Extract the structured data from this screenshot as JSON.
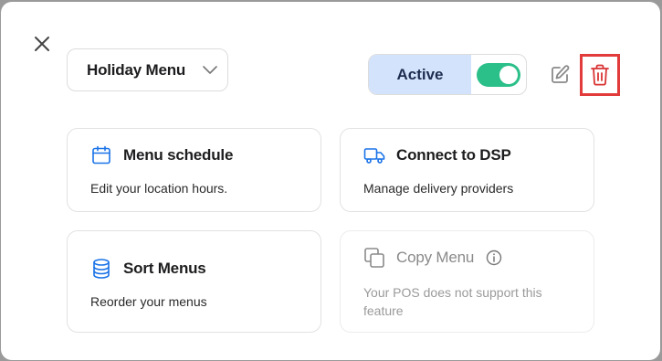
{
  "menu_selector": {
    "value": "Holiday Menu"
  },
  "status": {
    "label": "Active",
    "toggle_on": true
  },
  "colors": {
    "accent": "#1a73e8",
    "active_bg": "#d3e3fc",
    "toggle": "#2bbf8a",
    "delete": "#e23b3b"
  },
  "cards": [
    {
      "title": "Menu schedule",
      "description": "Edit your location hours.",
      "icon": "calendar-icon",
      "enabled": true
    },
    {
      "title": "Connect to DSP",
      "description": "Manage delivery providers",
      "icon": "truck-icon",
      "enabled": true
    },
    {
      "title": "Sort Menus",
      "description": "Reorder your menus",
      "icon": "database-icon",
      "enabled": true
    },
    {
      "title": "Copy Menu",
      "description": "Your POS does not support this feature",
      "icon": "copy-icon",
      "enabled": false
    }
  ]
}
